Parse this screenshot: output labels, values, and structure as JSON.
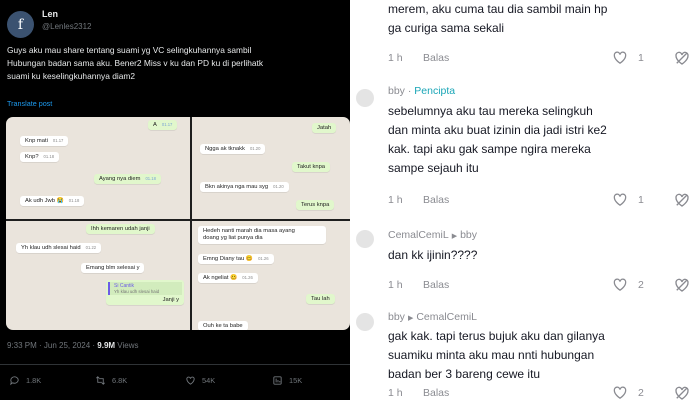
{
  "tweet": {
    "avatar_letter": "f",
    "display_name": "Len",
    "handle": "@Lenles2312",
    "text_lines": [
      "Guys aku mau share tentang suami yg VC selingkuhannya sambil",
      "Hubungan badan sama aku. Bener2 Miss v ku dan PD ku di perlihatk",
      "suami ku keselingkuhannya diam2"
    ],
    "translate_label": "Translate post",
    "media": {
      "shot1": [
        {
          "text": "Knp mati",
          "time": "01.17"
        },
        {
          "text": "Knp?",
          "time": "01.18"
        },
        {
          "text": "Ayang nya diem",
          "time": "01.18"
        },
        {
          "text": "Ak udh Jwb 😭",
          "time": "01.18"
        },
        {
          "text": "A",
          "time": "01.17"
        }
      ],
      "shot2": [
        {
          "text": "Jatah",
          "time": "01.20"
        },
        {
          "text": "Ngga ak tknakk",
          "time": "01.20"
        },
        {
          "text": "Takut knpa",
          "time": "01.20"
        },
        {
          "text": "Bkn akinya nga mau syg",
          "time": "01.20"
        },
        {
          "text": "Terus knpa",
          "time": "01.21"
        }
      ],
      "shot3": [
        {
          "text": "Ihh kemaren udah janji",
          "time": "01.22"
        },
        {
          "text": "Yh klau udh slesai haid",
          "time": "01.22"
        },
        {
          "text": "Emang blm selesai y",
          "time": "01.22"
        },
        {
          "quote_name": "Si Cantik",
          "quote_text": "Yh klau udh slesai haid",
          "text": "Janji y",
          "time": "01.22"
        }
      ],
      "shot4": [
        {
          "text": "Hedeh nanti marah dia masa ayang",
          "text2": "doang yg liat punya dia",
          "time": "01.26"
        },
        {
          "text": "Emng Diany tau 🥴",
          "time": "01.26"
        },
        {
          "text": "Ak ngeliat 🥴",
          "time": "01.26"
        },
        {
          "text": "Tau lah",
          "time": "01.26"
        },
        {
          "text": "Ouh ke ta babe",
          "time": ""
        }
      ]
    },
    "meta": {
      "time": "9:33 PM · Jun 25, 2024 · ",
      "views": "9.9M",
      "views_label": " Views"
    },
    "actions": {
      "replies": "1.8K",
      "reposts": "6.8K",
      "likes": "54K",
      "bookmarks": "15K"
    }
  },
  "comments": [
    {
      "lines": [
        "merem, aku cuma tau dia sambil main hp",
        "ga curiga sama sekali"
      ],
      "time": "1 h",
      "reply_label": "Balas",
      "likes": "1"
    },
    {
      "user": "bby",
      "creator_label": "Pencipta",
      "lines": [
        "sebelumnya aku tau mereka selingkuh",
        "dan minta aku buat izinin dia jadi istri ke2",
        "kak. tapi aku gak sampe ngira mereka",
        "sampe sejauh itu"
      ],
      "time": "1 h",
      "reply_label": "Balas",
      "likes": "1"
    },
    {
      "user": "CemalCemiL",
      "reply_to": "bby",
      "lines": [
        "dan kk ijinin????"
      ],
      "time": "1 h",
      "reply_label": "Balas",
      "likes": "2"
    },
    {
      "user": "bby",
      "reply_to": "CemalCemiL",
      "lines": [
        "gak kak. tapi terus bujuk aku dan gilanya",
        "suamiku minta aku mau nnti hubungan",
        "badan ber 3 bareng cewe itu"
      ],
      "time": "1 h",
      "reply_label": "Balas",
      "likes": "2"
    }
  ],
  "colors": {
    "twitter_bg": "#000000",
    "link_blue": "#1d9bf0",
    "creator_teal": "#1aa6b7",
    "muted": "#8a8b91"
  },
  "icons": [
    "reply-icon",
    "repost-icon",
    "like-icon",
    "bookmark-icon",
    "heart-icon",
    "dislike-icon"
  ]
}
